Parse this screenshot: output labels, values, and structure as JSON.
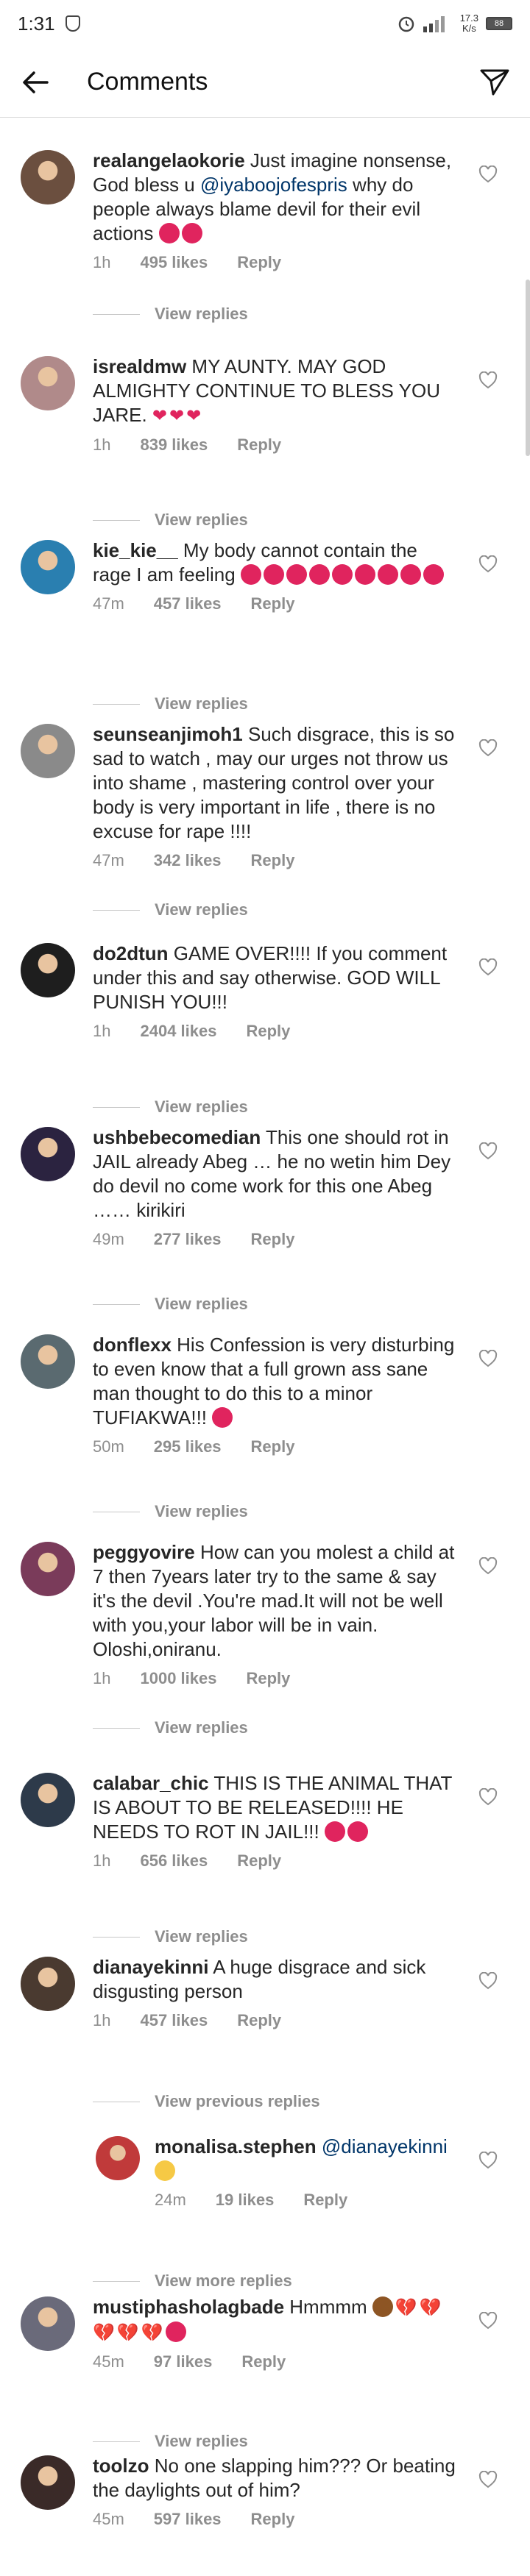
{
  "status_bar": {
    "time": "1:31",
    "speed": "17.3\nK/s",
    "signal_label": "3G",
    "battery": "88"
  },
  "header": {
    "title": "Comments"
  },
  "view_replies_label": "View replies",
  "comments": [
    {
      "user": "realangelaokorie",
      "text_before": "Just imagine nonsense, God bless u ",
      "mention": "@iyaboojofespris",
      "text_after": " why do people always blame devil for their evil actions ",
      "emoji": [
        "angry",
        "angry"
      ],
      "time": "1h",
      "likes": "495 likes",
      "reply": "Reply",
      "more": "View replies"
    },
    {
      "user": "isrealdmw",
      "text_before": "MY AUNTY. MAY GOD ALMIGHTY CONTINUE TO BLESS YOU JARE. ",
      "emoji": [
        "heart",
        "heart",
        "heart"
      ],
      "time": "1h",
      "likes": "839 likes",
      "reply": "Reply",
      "more": "View replies"
    },
    {
      "user": "kie_kie__",
      "text_before": "My body cannot contain the rage I am feeling ",
      "emoji": [
        "angry",
        "angry",
        "angry",
        "angry",
        "angry",
        "angry",
        "angry",
        "angry",
        "angry"
      ],
      "time": "47m",
      "likes": "457 likes",
      "reply": "Reply",
      "more": "View replies"
    },
    {
      "user": "seunseanjimoh1",
      "text_before": "Such disgrace, this is so sad to watch , may our urges not throw us into shame , mastering control over your body is very important in life , there is no excuse for rape !!!!",
      "time": "47m",
      "likes": "342 likes",
      "reply": "Reply",
      "more": "View replies"
    },
    {
      "user": "do2dtun",
      "text_before": "GAME OVER!!!! If you comment under this and say otherwise. GOD WILL PUNISH YOU!!!",
      "time": "1h",
      "likes": "2404 likes",
      "reply": "Reply",
      "more": "View replies"
    },
    {
      "user": "ushbebecomedian",
      "text_before": "This one should rot in JAIL already Abeg … he no wetin him Dey do devil no come work for this one Abeg …… kirikiri",
      "time": "49m",
      "likes": "277 likes",
      "reply": "Reply",
      "more": "View replies"
    },
    {
      "user": "donflexx",
      "text_before": "His Confession is very disturbing to even know that a full grown ass sane man thought to do this to a minor TUFIAKWA!!! ",
      "emoji": [
        "angry"
      ],
      "time": "50m",
      "likes": "295 likes",
      "reply": "Reply",
      "more": "View replies"
    },
    {
      "user": "peggyovire",
      "text_before": "How can you molest a child at 7 then 7years later try to the same & say it's the devil .You're mad.It will not be well with you,your labor will be in vain. Oloshi,oniranu.",
      "time": "1h",
      "likes": "1000 likes",
      "reply": "Reply",
      "more": "View replies"
    },
    {
      "user": "calabar_chic",
      "text_before": "THIS IS THE ANIMAL THAT IS ABOUT TO BE RELEASED!!!! HE NEEDS TO ROT IN JAIL!!! ",
      "emoji": [
        "angry",
        "angry"
      ],
      "time": "1h",
      "likes": "656 likes",
      "reply": "Reply",
      "more": "View replies"
    },
    {
      "user": "dianayekinni",
      "text_before": "A huge disgrace and sick disgusting person",
      "time": "1h",
      "likes": "457 likes",
      "reply": "Reply",
      "more": "View previous replies"
    },
    {
      "user": "monalisa.stephen",
      "mention": "@dianayekinni",
      "emoji": [
        "wave"
      ],
      "time": "24m",
      "likes": "19 likes",
      "reply": "Reply",
      "more": "View more replies",
      "is_reply": true
    },
    {
      "user": "mustiphasholagbade",
      "text_before": "Hmmmm ",
      "emoji": [
        "person",
        "broken",
        "broken",
        "broken",
        "broken",
        "broken",
        "angry"
      ],
      "time": "45m",
      "likes": "97 likes",
      "reply": "Reply",
      "more": "View replies"
    },
    {
      "user": "toolzo",
      "text_before": "No one slapping him??? Or beating the daylights out of him?",
      "time": "45m",
      "likes": "597 likes",
      "reply": "Reply",
      "more": "View replies"
    }
  ],
  "colors": {
    "accent_link": "#003569",
    "muted": "#8e8e8e",
    "text": "#262626",
    "heart_red": "#e0245e"
  }
}
